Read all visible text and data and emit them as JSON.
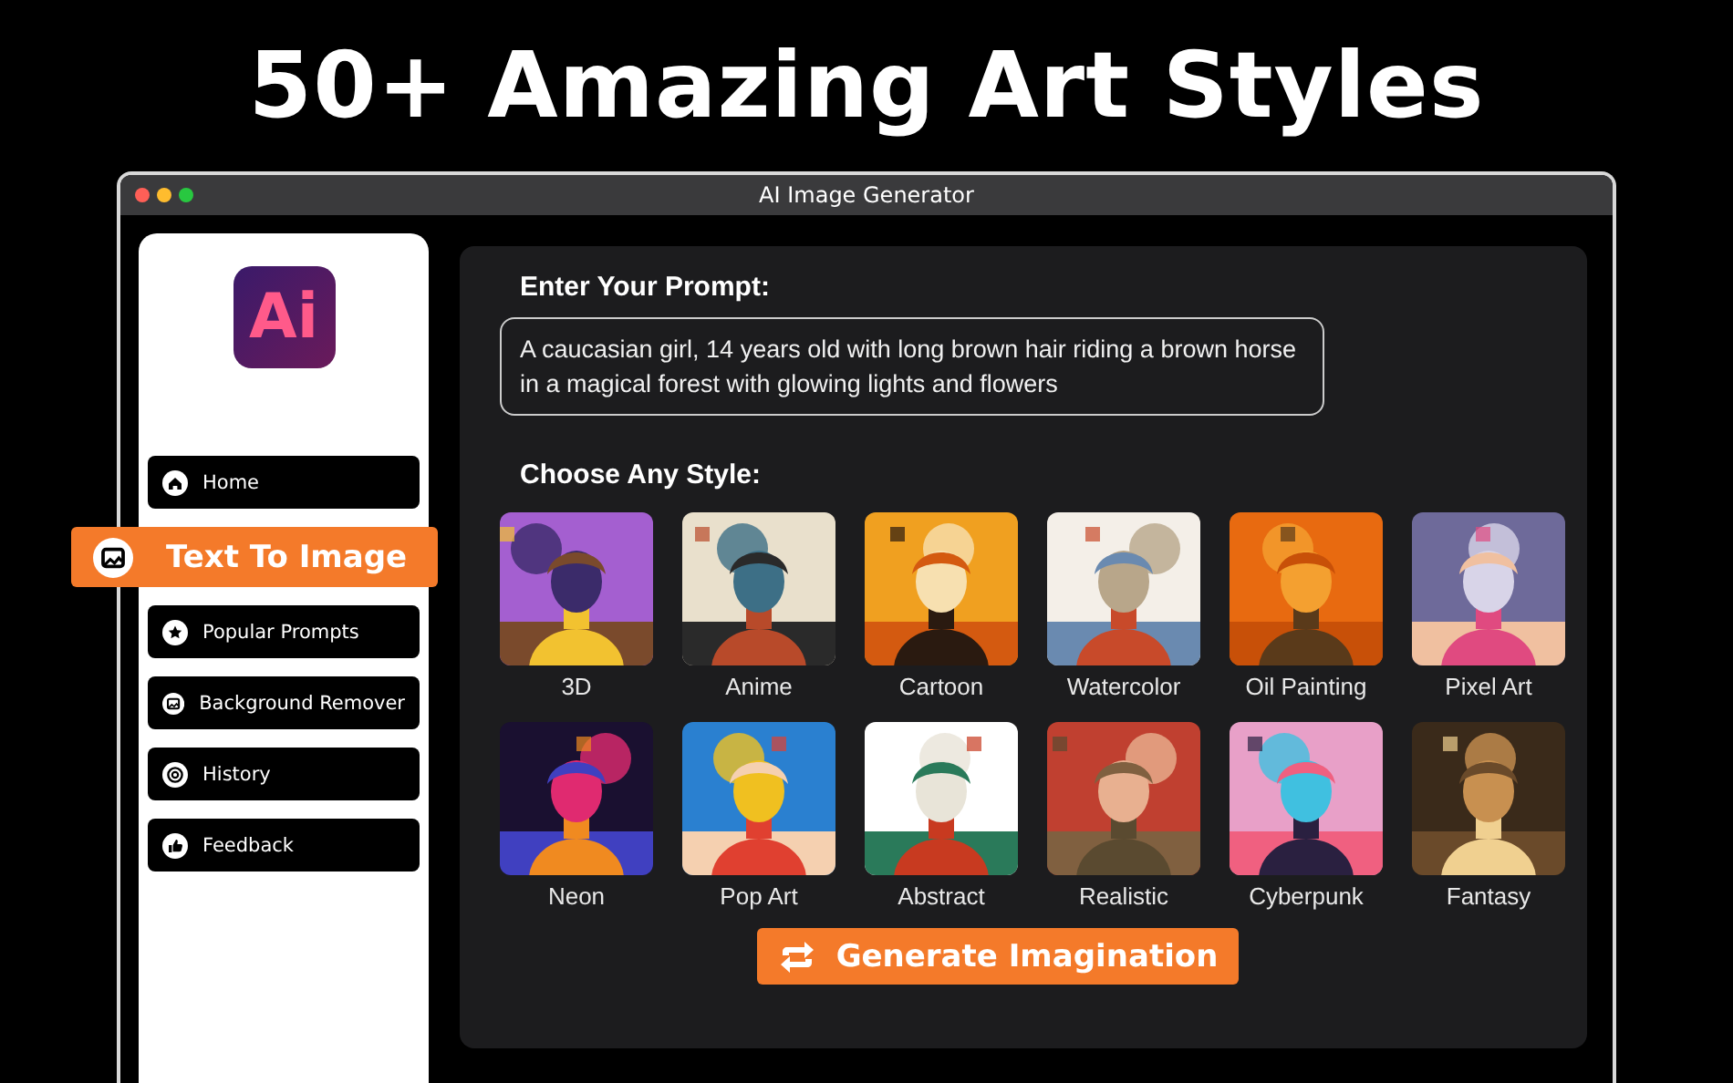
{
  "headline": "50+ Amazing Art Styles",
  "window": {
    "title": "AI Image Generator"
  },
  "sidebar": {
    "logo": "Ai",
    "items": [
      {
        "label": "Home",
        "selected": false
      },
      {
        "label": "Text To Image",
        "selected": true
      },
      {
        "label": "Popular Prompts",
        "selected": false
      },
      {
        "label": "Background Remover",
        "selected": false
      },
      {
        "label": "History",
        "selected": false
      },
      {
        "label": "Feedback",
        "selected": false
      }
    ]
  },
  "prompt": {
    "heading": "Enter Your Prompt:",
    "value": "A caucasian girl, 14 years old with long brown hair riding a brown horse in a magical forest with glowing lights and flowers"
  },
  "styles": {
    "heading": "Choose Any Style:",
    "items": [
      {
        "label": "3D"
      },
      {
        "label": "Anime"
      },
      {
        "label": "Cartoon"
      },
      {
        "label": "Watercolor"
      },
      {
        "label": "Oil Painting"
      },
      {
        "label": "Pixel Art"
      },
      {
        "label": "Neon"
      },
      {
        "label": "Pop Art"
      },
      {
        "label": "Abstract"
      },
      {
        "label": "Realistic"
      },
      {
        "label": "Cyberpunk"
      },
      {
        "label": "Fantasy"
      }
    ]
  },
  "generate_button": "Generate Imagination"
}
